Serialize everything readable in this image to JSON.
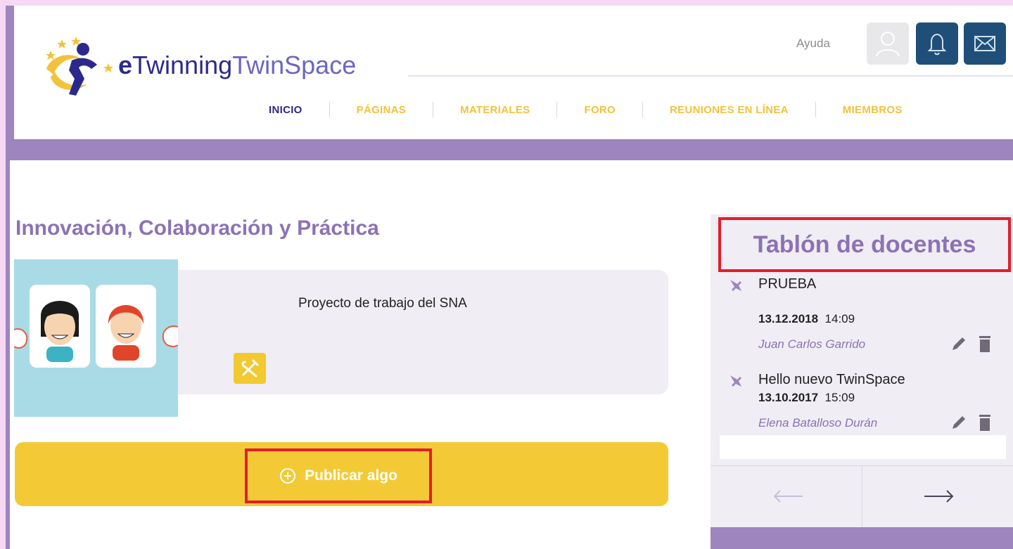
{
  "header": {
    "logo_e": "e",
    "logo_twinning": "Twinning",
    "logo_twinspace": "TwinSpace",
    "help_label": "Ayuda",
    "icons": [
      "user-icon",
      "bell-icon",
      "mail-icon"
    ]
  },
  "nav": {
    "items": [
      {
        "label": "INICIO",
        "color": "#2b2a8c"
      },
      {
        "label": "PÁGINAS",
        "color": "#f2c23a"
      },
      {
        "label": "MATERIALES",
        "color": "#f2c23a"
      },
      {
        "label": "FORO",
        "color": "#f2c23a"
      },
      {
        "label": "REUNIONES EN LÍNEA",
        "color": "#f2c23a"
      },
      {
        "label": "MIEMBROS",
        "color": "#f2c23a"
      }
    ]
  },
  "main": {
    "title": "Innovación, Colaboración y Práctica",
    "project_description": "Proyecto de trabajo del SNA",
    "publish_label": "Publicar algo"
  },
  "board": {
    "title": "Tablón de docentes",
    "posts": [
      {
        "title": "PRUEBA",
        "date": "13.12.2018",
        "time": "14:09",
        "author": "Juan Carlos Garrido"
      },
      {
        "title": "Hello nuevo TwinSpace",
        "date": "13.10.2017",
        "time": "15:09",
        "author": "Elena Batalloso Durán"
      }
    ]
  },
  "colors": {
    "accent_purple": "#9e85bd",
    "title_purple": "#8c72b4",
    "navy": "#1f4f78",
    "yellow": "#f3ca36",
    "highlight_red": "#e51c2a"
  }
}
